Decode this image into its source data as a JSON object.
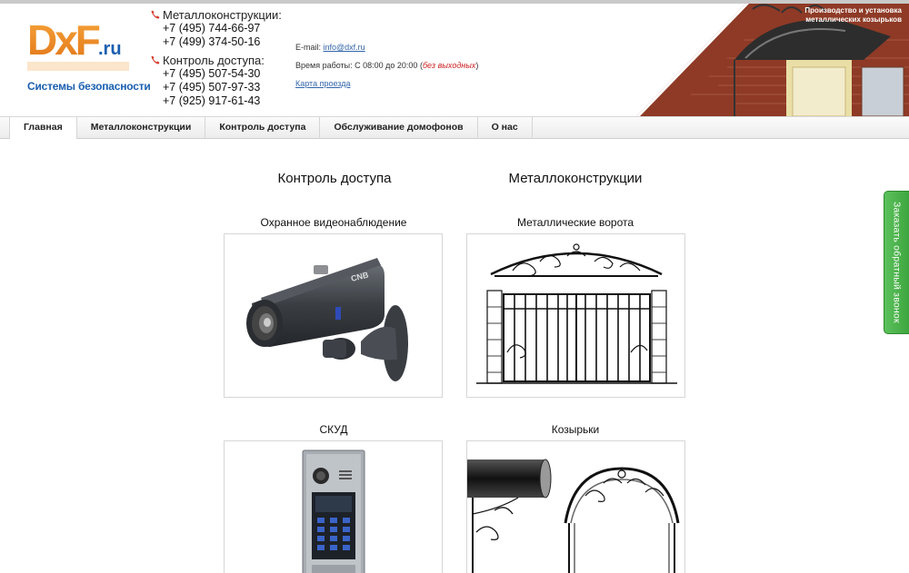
{
  "header": {
    "logo_text": "DxF.ru",
    "tagline": "Системы безопасности",
    "contacts": [
      {
        "title": "Металлоконструкции:",
        "phones": [
          "+7 (495) 744-66-97",
          "+7 (499) 374-50-16"
        ]
      },
      {
        "title": "Контроль доступа:",
        "phones": [
          "+7 (495) 507-54-30",
          "+7 (495) 507-97-33",
          "+7 (925) 917-61-43"
        ]
      }
    ],
    "email_label": "E-mail:",
    "email": "info@dxf.ru",
    "hours_label": "Время работы: С 08:00 до 20:00 (",
    "hours_note": "без выходных",
    "hours_end": ")",
    "map_link": "Карта проезда",
    "banner_line1": "Производство и установка",
    "banner_line2": "металлических козырьков"
  },
  "nav": {
    "items": [
      "Главная",
      "Металлоконструкции",
      "Контроль доступа",
      "Обслуживание домофонов",
      "О нас"
    ],
    "active": "Главная"
  },
  "sections": [
    {
      "title": "Контроль доступа",
      "cards": [
        "Охранное видеонаблюдение",
        "СКУД"
      ]
    },
    {
      "title": "Металлоконструкции",
      "cards": [
        "Металлические ворота",
        "Козырьки"
      ]
    }
  ],
  "callback": {
    "label": "Заказать обратный звонок"
  },
  "colors": {
    "accent_green": "#4cb34c",
    "tagline_blue": "#1a5fb0",
    "logo_orange": "#f08a1c",
    "link_blue": "#3366aa"
  }
}
